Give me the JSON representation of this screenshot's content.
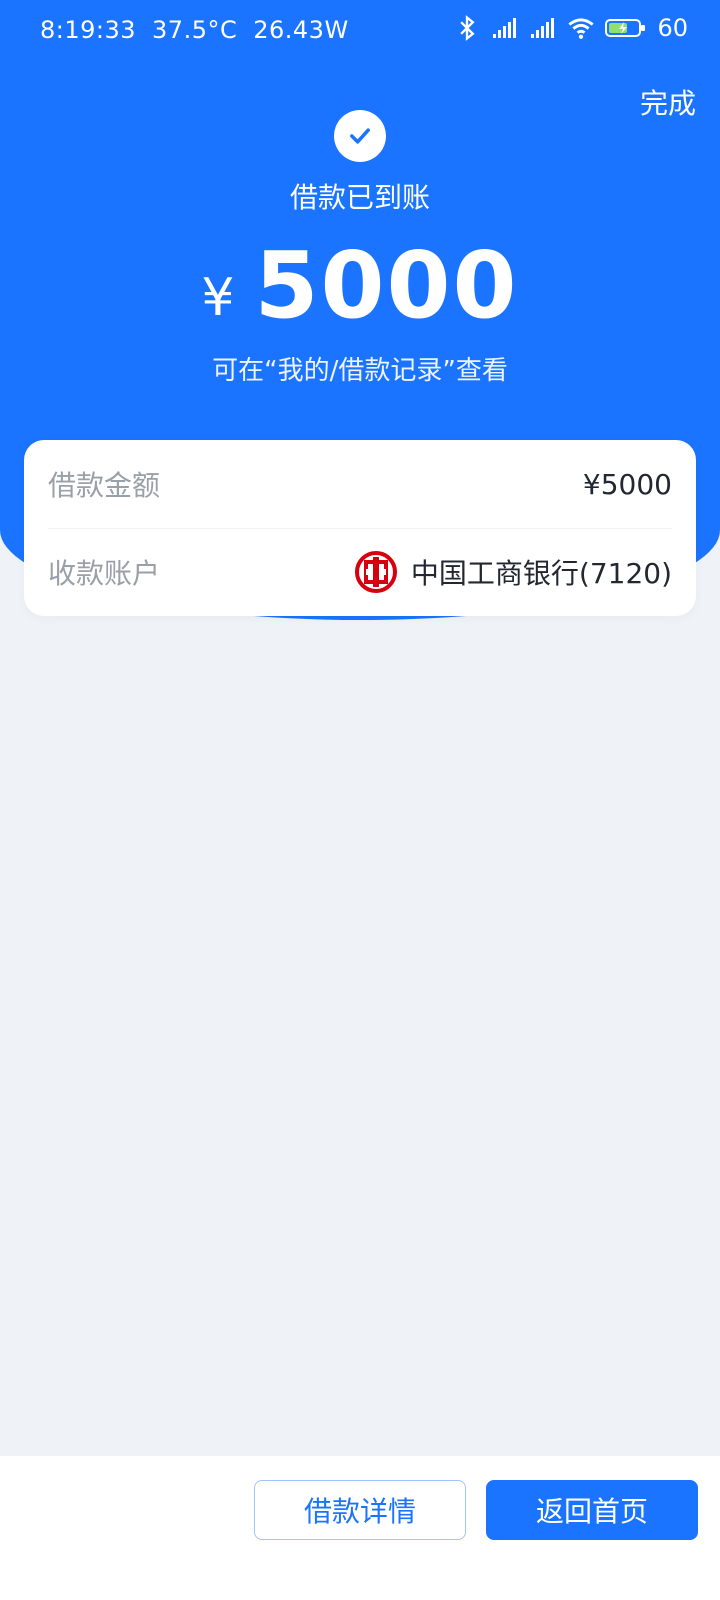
{
  "status_bar": {
    "time": "8:19:33",
    "temperature": "37.5°C",
    "power": "26.43W",
    "battery": "60"
  },
  "header": {
    "done_label": "完成"
  },
  "success": {
    "title": "借款已到账",
    "currency_symbol": "¥",
    "amount": "5000",
    "hint": "可在“我的/借款记录”查看"
  },
  "details": {
    "rows": [
      {
        "label": "借款金额",
        "value": "¥5000"
      },
      {
        "label": "收款账户",
        "value": "中国工商银行(7120)"
      }
    ]
  },
  "actions": {
    "details_label": "借款详情",
    "home_label": "返回首页"
  },
  "colors": {
    "primary": "#1a74ff",
    "background": "#eff3f8",
    "bank_logo": "#d7000f"
  },
  "icons": {
    "success": "check-circle-icon",
    "bank": "icbc-bank-logo-icon"
  }
}
